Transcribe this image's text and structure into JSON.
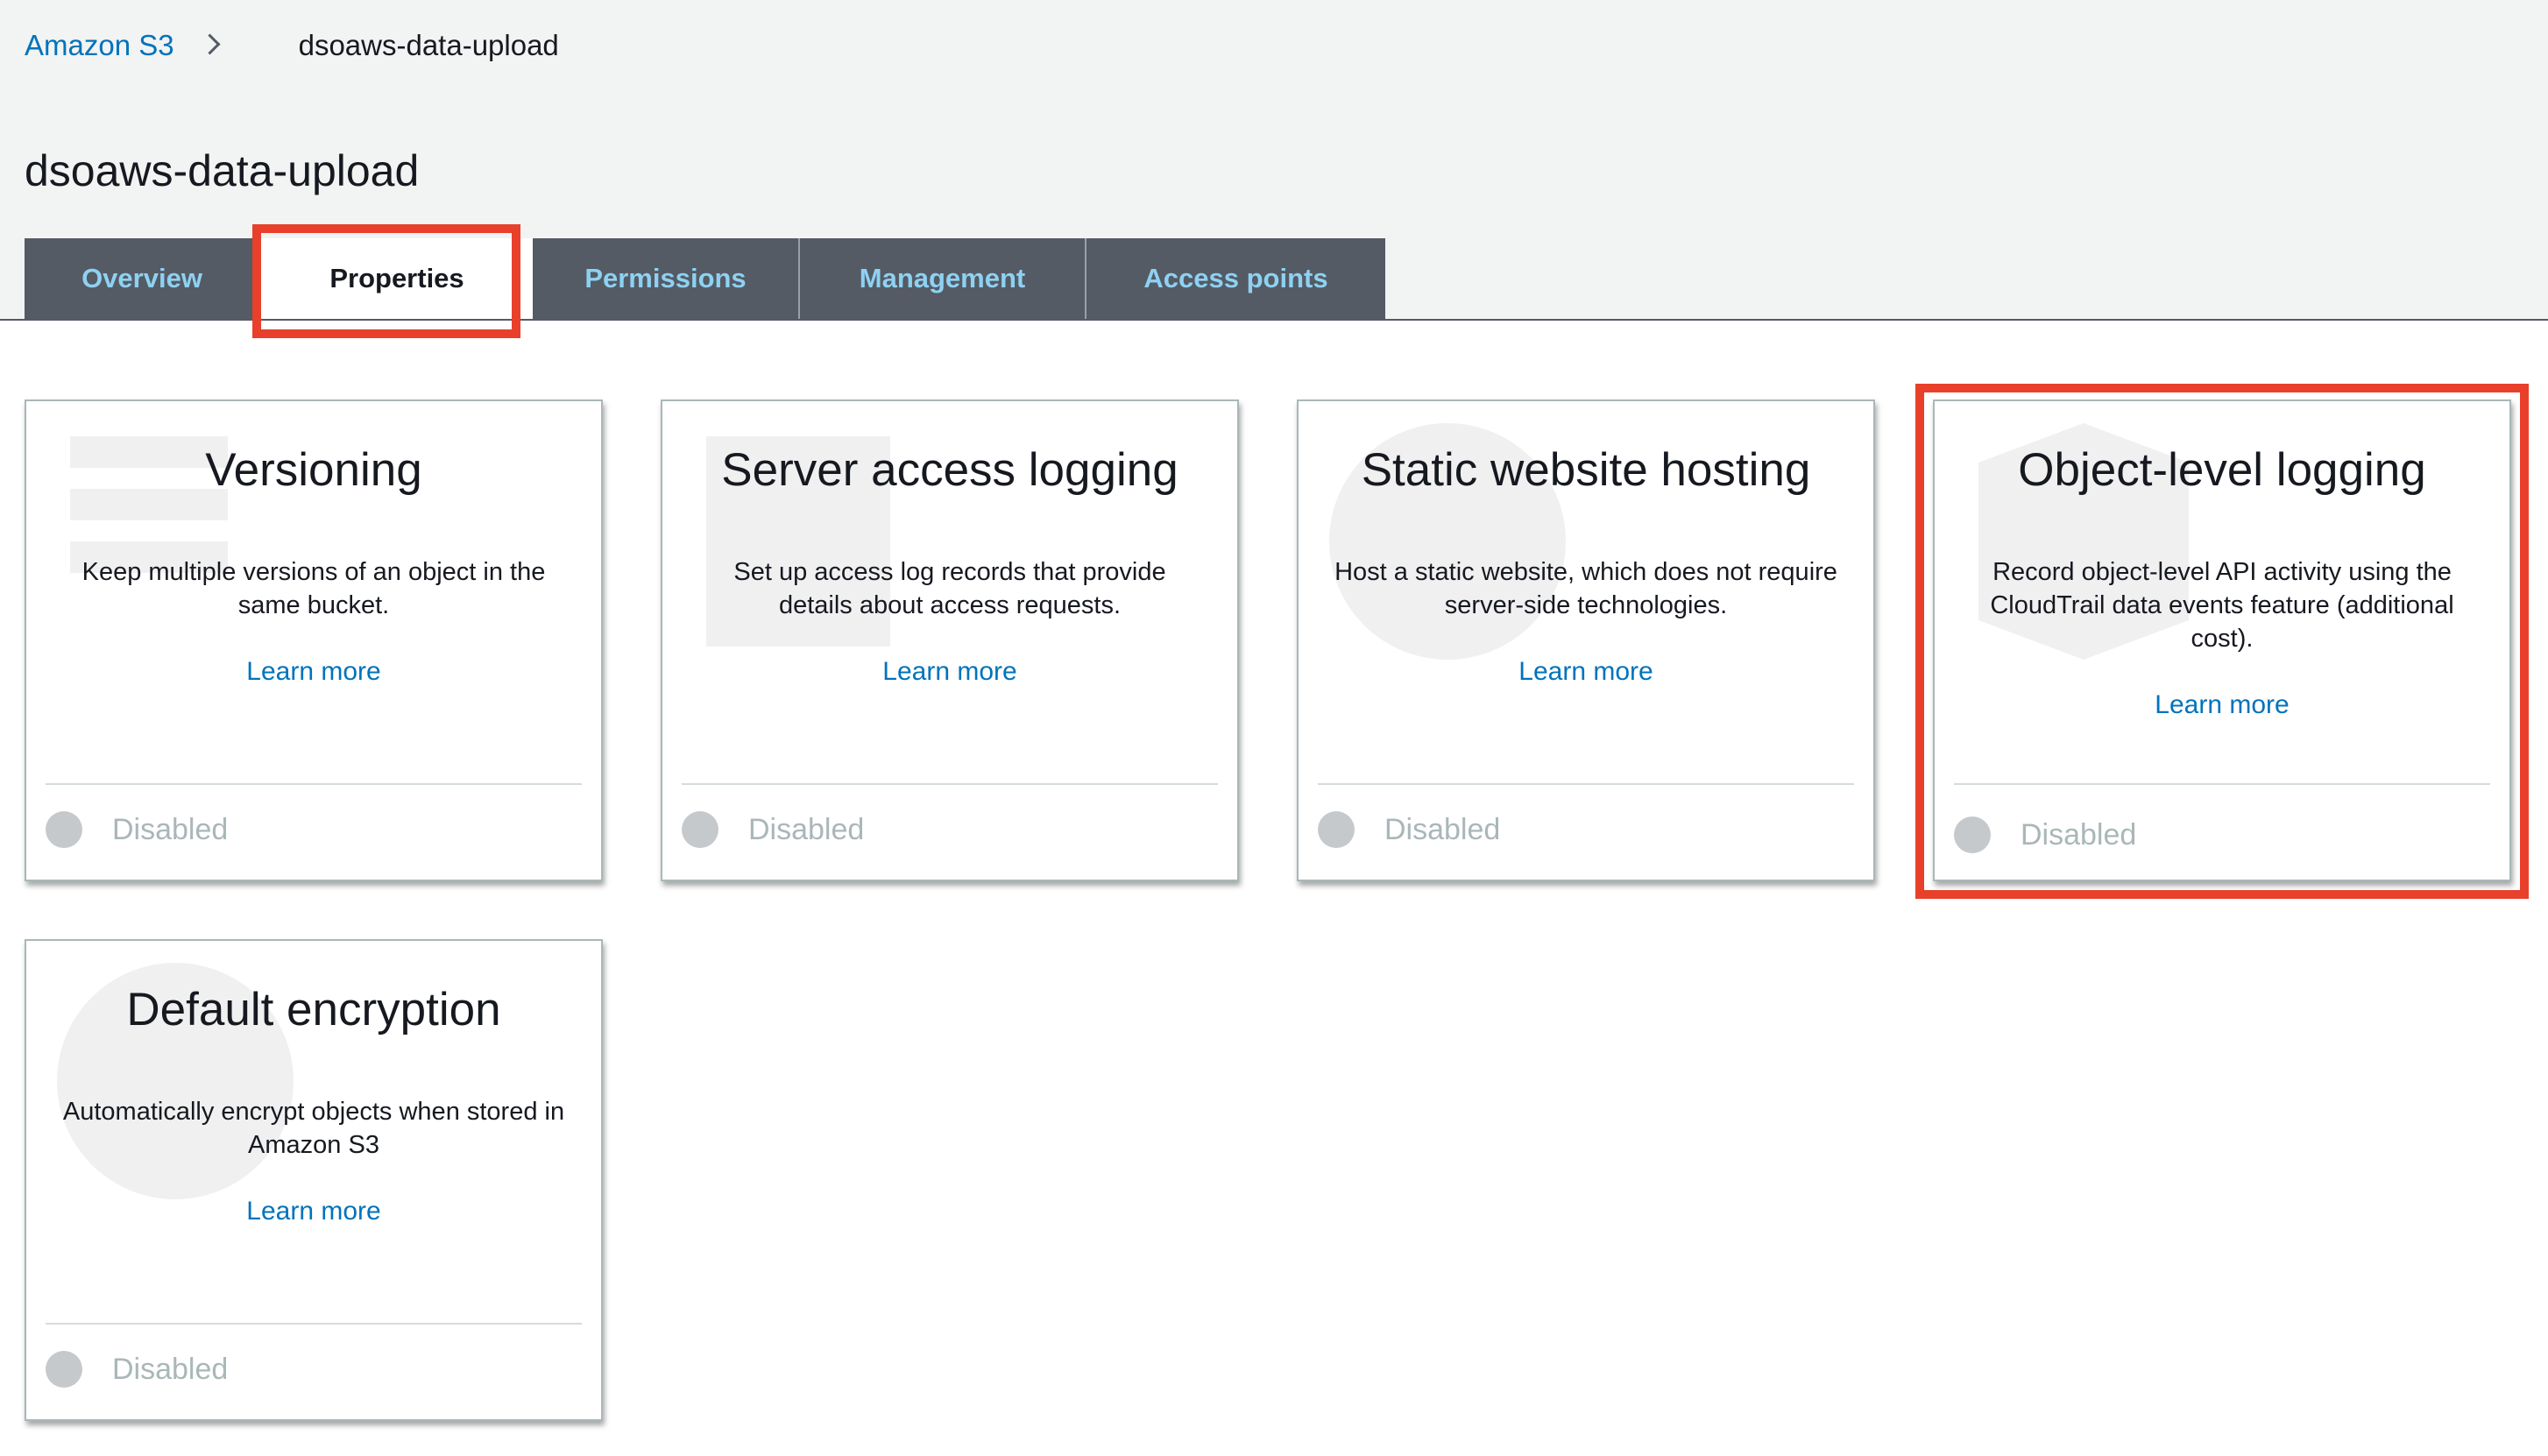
{
  "breadcrumb": {
    "root": "Amazon S3",
    "current": "dsoaws-data-upload"
  },
  "page_title": "dsoaws-data-upload",
  "tabs": [
    "Overview",
    "Properties",
    "Permissions",
    "Management",
    "Access points"
  ],
  "active_tab": "Properties",
  "cards": [
    {
      "title": "Versioning",
      "description": "Keep multiple versions of an object in the same bucket.",
      "link": "Learn more",
      "status": "Disabled"
    },
    {
      "title": "Server access logging",
      "description": "Set up access log records that provide details about access requests.",
      "link": "Learn more",
      "status": "Disabled"
    },
    {
      "title": "Static website hosting",
      "description": "Host a static website, which does not require server-side technologies.",
      "link": "Learn more",
      "status": "Disabled"
    },
    {
      "title": "Object-level logging",
      "description": "Record object-level API activity using the CloudTrail data events feature (additional cost).",
      "link": "Learn more",
      "status": "Disabled"
    },
    {
      "title": "Default encryption",
      "description": "Automatically encrypt objects when stored in Amazon S3",
      "link": "Learn more",
      "status": "Disabled"
    }
  ],
  "colors": {
    "highlight": "#e8402b",
    "tab_bg": "#545b64",
    "tab_text": "#8ed1f2",
    "link": "#0073bb",
    "status_dot": "#c6c9cc"
  },
  "icons": [
    "chevron-right-icon",
    "status-dot-icon"
  ]
}
